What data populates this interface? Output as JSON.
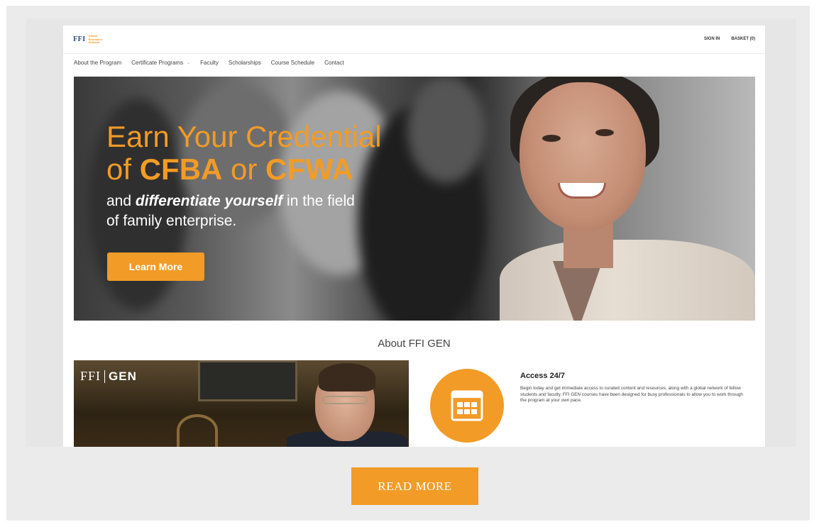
{
  "header": {
    "logo_text": "FFI",
    "logo_sub": [
      "Global",
      "Education",
      "Network"
    ],
    "sign_in": "SIGN IN",
    "basket": "BASKET (0)"
  },
  "nav": {
    "items": [
      {
        "label": "About the Program"
      },
      {
        "label": "Certificate Programs",
        "caret": "⌄"
      },
      {
        "label": "Faculty"
      },
      {
        "label": "Scholarships"
      },
      {
        "label": "Course Schedule"
      },
      {
        "label": "Contact"
      }
    ]
  },
  "hero": {
    "line1": "Earn Your Credential",
    "line2_prefix": "of ",
    "line2_a": "CFBA",
    "line2_mid": " or ",
    "line2_b": "CFWA",
    "sub1_prefix": "and ",
    "sub1_em": "differentiate yourself",
    "sub1_suffix": " in the field",
    "sub2": "of family enterprise.",
    "button": "Learn More"
  },
  "about": {
    "title": "About FFI GEN",
    "video_logo_left": "FFI",
    "video_logo_right": "GEN",
    "feature_title": "Access 24/7",
    "feature_text": "Begin today and get immediate access to curated content and resources, along with a global network of fellow students and faculty. FFI GEN courses have been designed for busy professionals to allow you to work through the program at your own pace."
  },
  "footer": {
    "read_more": "READ MORE"
  },
  "colors": {
    "accent": "#f29b26",
    "logo_blue": "#2b4a7a",
    "frame_bg": "#ebebeb"
  }
}
